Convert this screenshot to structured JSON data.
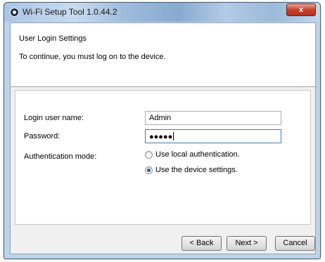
{
  "window": {
    "title": "Wi-Fi Setup Tool 1.0.44.2",
    "close_label": "x"
  },
  "header": {
    "title": "User Login Settings",
    "subtitle": "To continue, you must log on to the device."
  },
  "form": {
    "username_label": "Login user name:",
    "username_value": "Admin",
    "password_label": "Password:",
    "password_value": "●●●●●",
    "auth_mode_label": "Authentication mode:",
    "auth_options": [
      {
        "label": "Use local authentication.",
        "selected": false
      },
      {
        "label": "Use the device settings.",
        "selected": true
      }
    ]
  },
  "buttons": {
    "back": "< Back",
    "next": "Next >",
    "cancel": "Cancel"
  }
}
